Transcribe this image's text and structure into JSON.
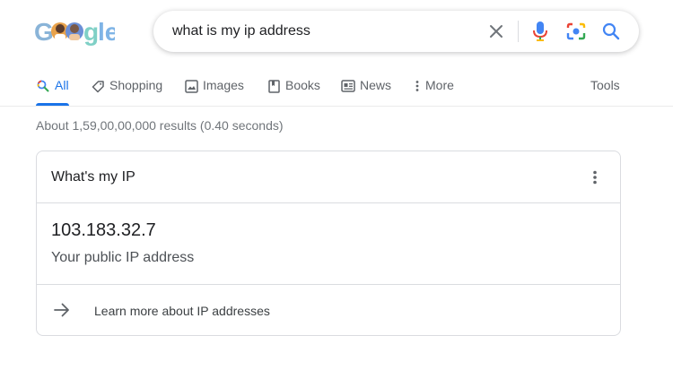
{
  "search": {
    "query": "what is my ip address"
  },
  "tabs": [
    {
      "label": "All",
      "icon": "search-icon"
    },
    {
      "label": "Shopping",
      "icon": "tag-icon"
    },
    {
      "label": "Images",
      "icon": "image-icon"
    },
    {
      "label": "Books",
      "icon": "book-icon"
    },
    {
      "label": "News",
      "icon": "news-icon"
    },
    {
      "label": "More",
      "icon": "more-vert-icon"
    }
  ],
  "tools_label": "Tools",
  "result_stats": "About 1,59,00,00,000 results (0.40 seconds)",
  "card": {
    "title": "What's my IP",
    "ip": "103.183.32.7",
    "ip_label": "Your public IP address",
    "link_text": "Learn more about IP addresses"
  },
  "colors": {
    "accent": "#1a73e8",
    "muted": "#5f6368",
    "border": "#dadce0"
  }
}
